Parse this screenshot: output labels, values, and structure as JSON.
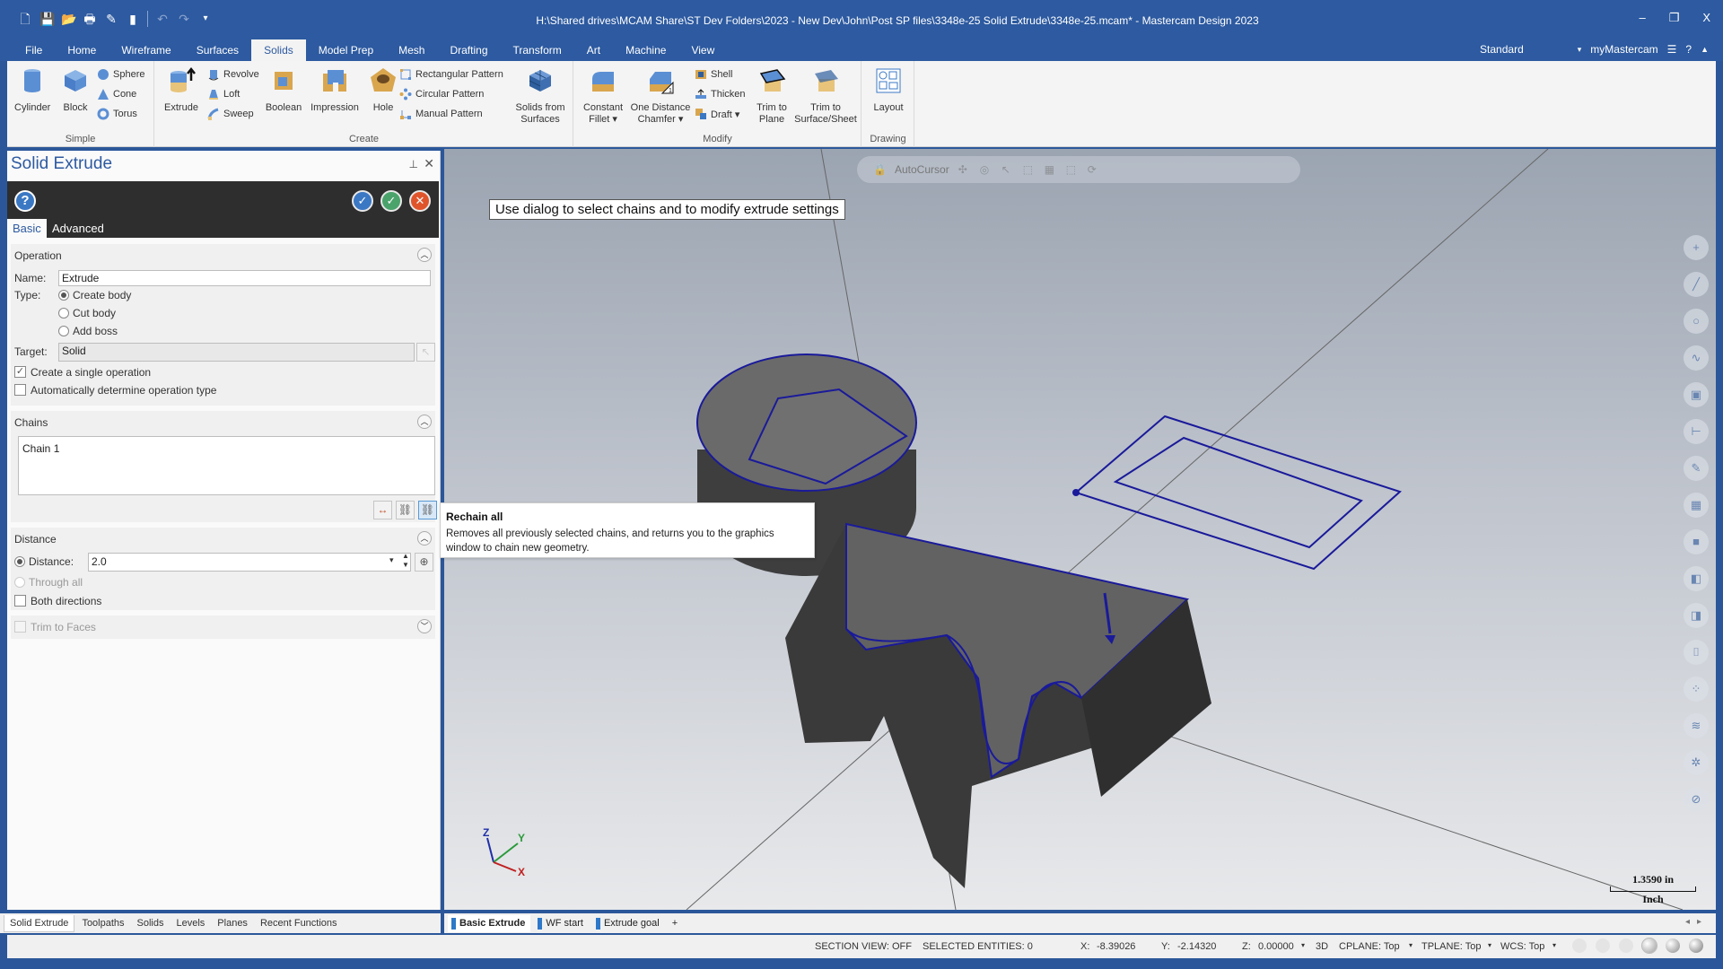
{
  "window": {
    "title": "H:\\Shared drives\\MCAM Share\\ST Dev Folders\\2023 - New Dev\\John\\Post SP files\\3348e-25 Solid Extrude\\3348e-25.mcam* - Mastercam Design 2023",
    "minimize": "–",
    "restore": "❐",
    "close": "X"
  },
  "quick_access": [
    "new-file",
    "save",
    "open",
    "print",
    "save-as",
    "pin",
    "undo",
    "redo",
    "customize"
  ],
  "ribbon_tabs": [
    "File",
    "Home",
    "Wireframe",
    "Surfaces",
    "Solids",
    "Model Prep",
    "Mesh",
    "Drafting",
    "Transform",
    "Art",
    "Machine",
    "View"
  ],
  "active_ribbon_tab": "Solids",
  "ribbon_right": {
    "workspace": "Standard",
    "account": "myMastercam"
  },
  "ribbon": {
    "simple": {
      "label": "Simple",
      "big": [
        {
          "label": "Cylinder"
        },
        {
          "label": "Block"
        }
      ],
      "small": [
        {
          "label": "Sphere"
        },
        {
          "label": "Cone"
        },
        {
          "label": "Torus"
        }
      ]
    },
    "create": {
      "label": "Create",
      "extrude": "Extrude",
      "small1": [
        {
          "label": "Revolve"
        },
        {
          "label": "Loft"
        },
        {
          "label": "Sweep"
        }
      ],
      "boolean": "Boolean",
      "impression": "Impression",
      "hole": "Hole",
      "small2": [
        {
          "label": "Rectangular Pattern"
        },
        {
          "label": "Circular Pattern"
        },
        {
          "label": "Manual Pattern"
        }
      ],
      "solids_from_surfaces_1": "Solids from",
      "solids_from_surfaces_2": "Surfaces"
    },
    "modify": {
      "label": "Modify",
      "fillet_1": "Constant",
      "fillet_2": "Fillet ▾",
      "chamfer_1": "One Distance",
      "chamfer_2": "Chamfer ▾",
      "small": [
        {
          "label": "Shell"
        },
        {
          "label": "Thicken"
        },
        {
          "label": "Draft ▾"
        }
      ],
      "trim_plane_1": "Trim to",
      "trim_plane_2": "Plane",
      "trim_surf_1": "Trim to",
      "trim_surf_2": "Surface/Sheet"
    },
    "drawing": {
      "label": "Drawing",
      "layout": "Layout"
    }
  },
  "panel": {
    "title": "Solid Extrude",
    "tabs": {
      "basic": "Basic",
      "advanced": "Advanced"
    },
    "operation": {
      "title": "Operation",
      "name_label": "Name:",
      "name_value": "Extrude",
      "type_label": "Type:",
      "types": [
        "Create body",
        "Cut body",
        "Add boss"
      ],
      "selected_type": "Create body",
      "target_label": "Target:",
      "target_value": "Solid",
      "single_op_label": "Create a single operation",
      "single_op_checked": true,
      "auto_type_label": "Automatically determine operation type",
      "auto_type_checked": false
    },
    "chains": {
      "title": "Chains",
      "items": [
        "Chain  1"
      ]
    },
    "distance": {
      "title": "Distance",
      "distance_label": "Distance:",
      "distance_value": "2.0",
      "through_all_label": "Through all",
      "both_directions_label": "Both directions",
      "both_directions_checked": false
    },
    "trim_to_faces_label": "Trim to Faces",
    "bottom_tabs": [
      "Solid Extrude",
      "Toolpaths",
      "Solids",
      "Levels",
      "Planes",
      "Recent Functions"
    ],
    "active_bottom_tab": "Solid Extrude"
  },
  "tooltip": {
    "title": "Rechain all",
    "body": "Removes all previously selected chains, and returns you to the graphics window to chain new geometry."
  },
  "viewport": {
    "prompt": "Use dialog to select chains and to modify extrude settings",
    "autocursor_label": "AutoCursor",
    "scale_value": "1.3590 in",
    "scale_unit": "Inch",
    "gnomon": {
      "x": "X",
      "y": "Y",
      "z": "Z"
    },
    "chain_color": "#1a1a9a"
  },
  "viewsheets": [
    "Basic Extrude",
    "WF start",
    "Extrude goal"
  ],
  "active_viewsheet": "Basic Extrude",
  "add_viewsheet": "+",
  "status": {
    "section_view": "SECTION VIEW: OFF",
    "selected": "SELECTED ENTITIES: 0",
    "x_label": "X:",
    "x_value": "-8.39026",
    "y_label": "Y:",
    "y_value": "-2.14320",
    "z_label": "Z:",
    "z_value": "0.00000",
    "mode": "3D",
    "cplane": "CPLANE: Top",
    "tplane": "TPLANE: Top",
    "wcs": "WCS: Top"
  }
}
